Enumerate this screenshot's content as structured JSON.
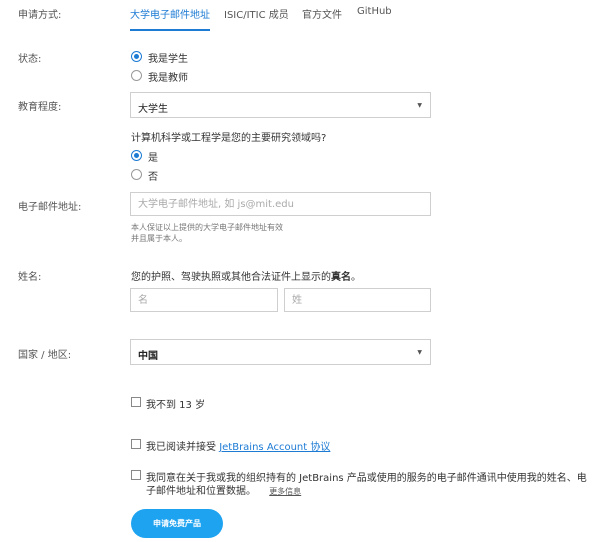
{
  "method": {
    "label": "申请方式:",
    "tabs": [
      {
        "label": "大学电子邮件地址"
      },
      {
        "label": "ISIC/ITIC 成员"
      },
      {
        "label": "官方文件"
      },
      {
        "label": "GitHub"
      }
    ]
  },
  "status": {
    "label": "状态:",
    "options": [
      {
        "label": "我是学生",
        "selected": true
      },
      {
        "label": "我是教师",
        "selected": false
      }
    ]
  },
  "education": {
    "label": "教育程度:",
    "selected": "大学生"
  },
  "cs_question": {
    "text": "计算机科学或工程学是您的主要研究领域吗?",
    "options": [
      {
        "label": "是",
        "selected": true
      },
      {
        "label": "否",
        "selected": false
      }
    ]
  },
  "email": {
    "label": "电子邮件地址:",
    "placeholder": "大学电子邮件地址, 如 js@mit.edu",
    "value": "",
    "hint_line1": "本人保证以上提供的大学电子邮件地址有效",
    "hint_line2": "并且属于本人。"
  },
  "name": {
    "label": "姓名:",
    "instruction_prefix": "您的护照、驾驶执照或其他合法证件上显示的",
    "instruction_bold": "真名",
    "instruction_suffix": "。",
    "first_placeholder": "名",
    "last_placeholder": "姓"
  },
  "country": {
    "label": "国家 / 地区:",
    "selected": "中国"
  },
  "checkboxes": {
    "under13": "我不到 13 岁",
    "agree_prefix": "我已阅读并接受 ",
    "agree_link": "JetBrains Account 协议",
    "consent_line1": "我同意在关于我或我的组织持有的 JetBrains 产品或使用的服务的电子邮件通讯中使用我的姓名、电",
    "consent_line2": "子邮件地址和位置数据。",
    "more_info": "更多信息"
  },
  "submit": {
    "label": "申请免费产品"
  },
  "colors": {
    "accent": "#1d7bd4",
    "button": "#1ea3f0"
  }
}
